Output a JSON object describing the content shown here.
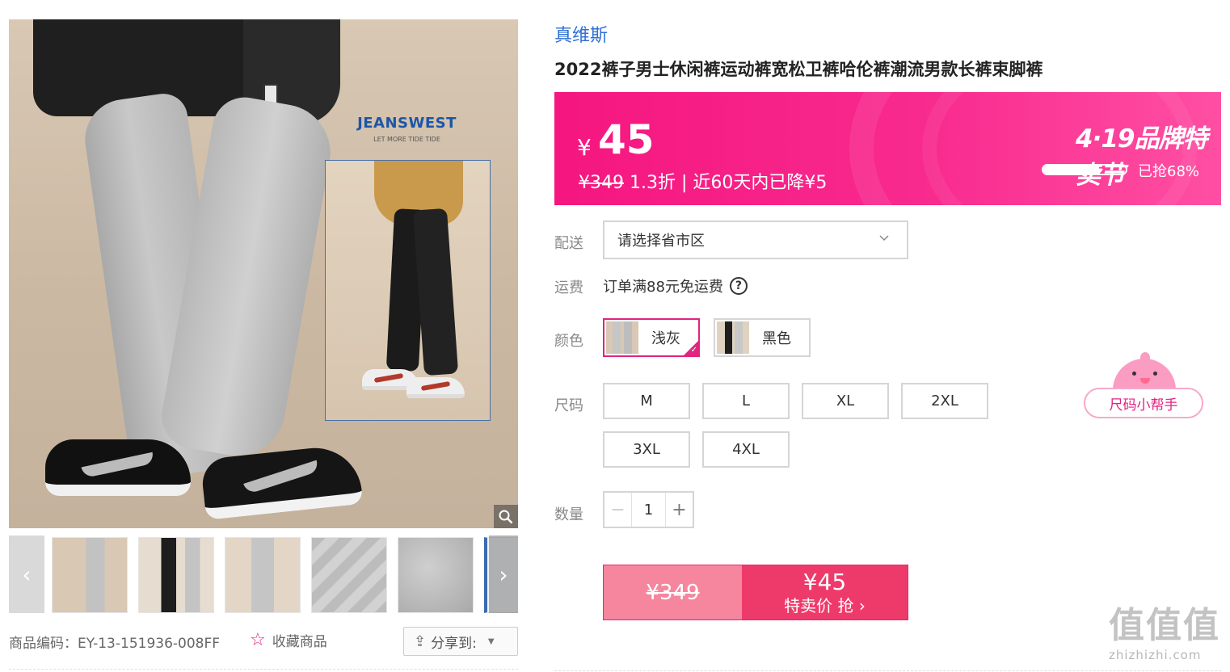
{
  "gallery": {
    "main_image_alt": "JEANSWEST 浅灰束脚卫裤模特图",
    "logo_text": "JEANSWEST",
    "logo_tagline": "LET MORE TIDE TIDE",
    "zoom_icon": "magnifier-icon",
    "prev_icon": "chevron-left-icon",
    "next_icon": "chevron-right-icon",
    "thumbnail_count": 6
  },
  "meta": {
    "sku_label": "商品编码：",
    "sku_value": "EY-13-151936-008FF",
    "favorite_label": "收藏商品",
    "favorite_icon": "star-outline-icon",
    "share_label": "分享到:",
    "share_icon": "share-icon"
  },
  "product": {
    "brand": "真维斯",
    "title": "2022裤子男士休闲裤运动裤宽松卫裤哈伦裤潮流男款长裤束脚裤"
  },
  "price": {
    "currency": "¥",
    "sale_price": "45",
    "original_price": "¥349",
    "discount_text": " 1.3折 | 近60天内已降¥5",
    "festival": "4·19品牌特卖节",
    "sold_label": "已抢68%",
    "sold_fraction": 0.68,
    "banner_color": "#f5167f"
  },
  "delivery": {
    "label": "配送",
    "select_value": "请选择省市区",
    "chevron_icon": "chevron-down-icon"
  },
  "shipping": {
    "label": "运费",
    "text": "订单满88元免运费",
    "help_icon": "question-circle-icon",
    "help_glyph": "?"
  },
  "color": {
    "label": "颜色",
    "options": [
      {
        "name": "浅灰",
        "selected": true
      },
      {
        "name": "黑色",
        "selected": false
      }
    ],
    "accent": "#e0247f"
  },
  "size": {
    "label": "尺码",
    "options": [
      "M",
      "L",
      "XL",
      "2XL",
      "3XL",
      "4XL"
    ],
    "helper_label": "尺码小帮手"
  },
  "quantity": {
    "label": "数量",
    "value": "1",
    "minus": "−",
    "plus": "+"
  },
  "buy": {
    "original": "¥349",
    "price": "¥45",
    "action": "特卖价 抢 ›"
  },
  "watermark": {
    "glyph": "值值值",
    "url": "zhizhizhi.com"
  }
}
